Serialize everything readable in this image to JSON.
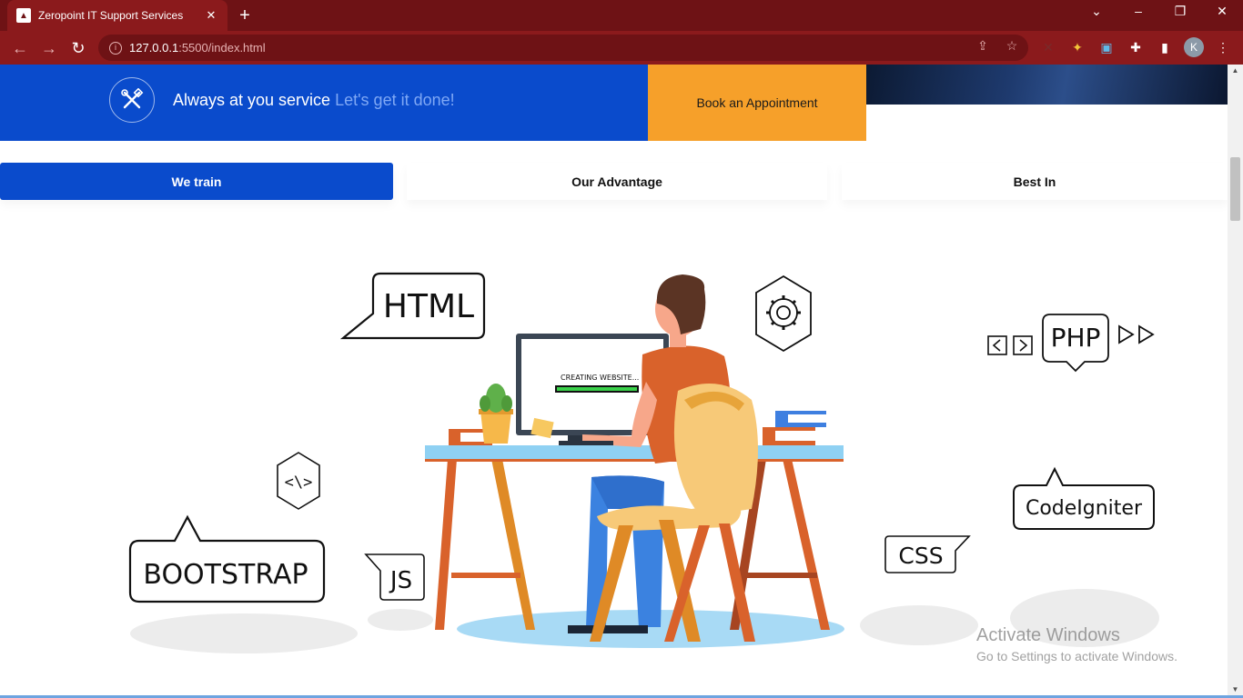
{
  "browser": {
    "tab_title": "Zeropoint IT Support Services",
    "tab_close": "✕",
    "new_tab": "+",
    "url_host": "127.0.0.1",
    "url_path": ":5500/index.html",
    "profile_initial": "K"
  },
  "banner": {
    "text_main": "Always at you service",
    "text_accent": "Let's get it done!",
    "book_button": "Book an Appointment"
  },
  "tabs": [
    {
      "label": "We train"
    },
    {
      "label": "Our Advantage"
    },
    {
      "label": "Best In"
    }
  ],
  "illustration": {
    "bubbles": {
      "html": "HTML",
      "php": "PHP",
      "bootstrap": "BOOTSTRAP",
      "js": "JS",
      "css": "CSS",
      "codeigniter": "CodeIgniter",
      "code_symbol": "<\\>"
    },
    "monitor_text": "CREATING WEBSITE..."
  },
  "watermark": {
    "title": "Activate Windows",
    "subtitle": "Go to Settings to activate Windows."
  },
  "colors": {
    "brand_blue": "#0a4bcc",
    "accent_orange": "#f6a02a",
    "chrome_red": "#8b1a1c"
  }
}
